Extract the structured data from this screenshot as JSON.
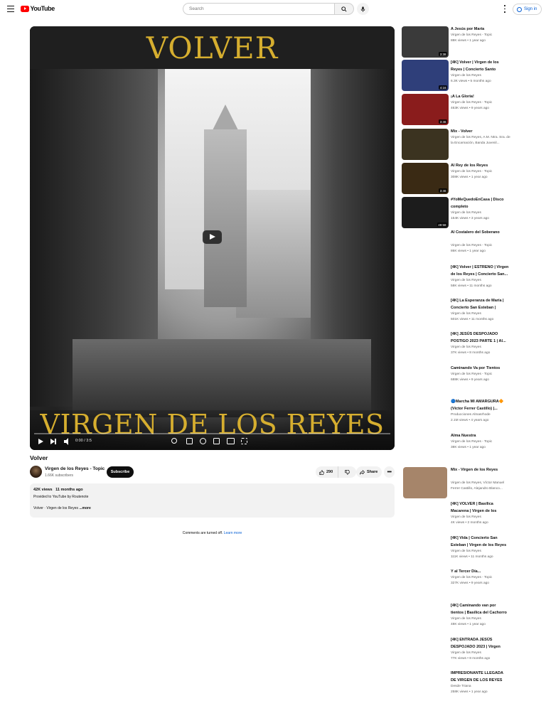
{
  "header": {
    "logo_text": "YouTube",
    "search_placeholder": "Search",
    "signin_label": "Sign in"
  },
  "player": {
    "overlay_title_top": "VOLVER",
    "overlay_title_bottom": "VIRGEN DE LOS REYES",
    "time": "0:00 / 3:5",
    "progress": 0
  },
  "video": {
    "title": "Volver",
    "channel_name": "Virgen de los Reyes - Topic",
    "subscribers": "1.66K subscribers",
    "subscribe_label": "Subscribe",
    "likes": "290",
    "share_label": "Share",
    "views": "42K views",
    "date": "11 months ago",
    "desc_line1": "Provided to YouTube by Routenote",
    "desc_line2": "Volver · Virgen de los Reyes",
    "more_label": "...more",
    "comments_off": "Comments are turned off.",
    "learn_more": "Learn more"
  },
  "recommendations": [
    {
      "title": "A Jesús por María",
      "channel": "Virgen de los Reyes - Topic",
      "meta": "88K views • 1 year ago",
      "duration": "3:38",
      "color": "#3a3a3a"
    },
    {
      "title": "[4K] Volver | Virgen de los Reyes | Concierto Santo Ángel...",
      "channel": "Virgen de los Reyes",
      "meta": "6.3K views • 5 months ago",
      "duration": "4:16",
      "color": "#2f3f7a"
    },
    {
      "title": "¡A La Gloria!",
      "channel": "Virgen de los Reyes - Topic",
      "meta": "463K views • 9 years ago",
      "duration": "3:46",
      "color": "#8a1c1c"
    },
    {
      "title": "Mix - Volver",
      "channel": "Virgen de los Reyes, A.M. Ntra. Sra. de la Encarnación, Banda Juvenil...",
      "meta": "",
      "duration": "",
      "color": "#3b3320"
    },
    {
      "title": "Al Rey de los Reyes",
      "channel": "Virgen de los Reyes - Topic",
      "meta": "308K views • 1 year ago",
      "duration": "3:46",
      "color": "#3a2a14"
    },
    {
      "title": "#YoMeQuedoEnCasa | Disco completo",
      "channel": "Virgen de los Reyes",
      "meta": "154K views • 3 years ago",
      "duration": "49:58",
      "color": "#1c1c1c"
    },
    {
      "title": "Al Costalero del Soberano",
      "channel": "Virgen de los Reyes - Topic",
      "meta": "86K views • 1 year ago",
      "duration": "",
      "color": ""
    },
    {
      "title": "[4K] Volver | ESTRENO | Virgen de los Reyes | Concierto San...",
      "channel": "Virgen de los Reyes",
      "meta": "58K views • 11 months ago",
      "duration": "",
      "color": ""
    },
    {
      "title": "[4K] La Esperanza de María | Concierto San Esteban | Virge...",
      "channel": "Virgen de los Reyes",
      "meta": "501K views • 11 months ago",
      "duration": "",
      "color": ""
    },
    {
      "title": "[4K] JESÚS DESPOJADO POSTIGO 2023 PARTE 1 | Al...",
      "channel": "Virgen de los Reyes",
      "meta": "37K views • 8 months ago",
      "duration": "",
      "color": ""
    },
    {
      "title": "Caminando Va por Tientos",
      "channel": "Virgen de los Reyes - Topic",
      "meta": "688K views • 9 years ago",
      "duration": "",
      "color": ""
    },
    {
      "title": "🔵Marcha MI AMARGURA🔶 (Víctor Ferrer Castillo) |...",
      "channel": "Producciones Almasrhode",
      "meta": "2.1M views • 4 years ago",
      "duration": "",
      "color": ""
    },
    {
      "title": "Alma Nuestra",
      "channel": "Virgen de los Reyes - Topic",
      "meta": "38K views • 1 year ago",
      "duration": "",
      "color": ""
    },
    {
      "title": "Mix - Virgen de los Reyes",
      "channel": "Virgen de los Reyes, Víctor Manuel Ferrer Castillo, Alejandro Blanco...",
      "meta": "",
      "duration": "",
      "color": "#a6856a"
    },
    {
      "title": "[4K] VOLVER | Basílica Macarena | Virgen de los Reye...",
      "channel": "Virgen de los Reyes",
      "meta": "4K views • 2 months ago",
      "duration": "",
      "color": ""
    },
    {
      "title": "[4K] Vida | Concierto San Esteban | Virgen de los Reyes",
      "channel": "Virgen de los Reyes",
      "meta": "111K views • 11 months ago",
      "duration": "",
      "color": ""
    },
    {
      "title": "Y al Tercer Día...",
      "channel": "Virgen de los Reyes - Topic",
      "meta": "327K views • 9 years ago",
      "duration": "",
      "color": ""
    },
    {
      "title": "[4K] Caminando van por tientos | Basílica del Cachorro",
      "channel": "Virgen de los Reyes",
      "meta": "48K views • 1 year ago",
      "duration": "",
      "color": ""
    },
    {
      "title": "[4K] ENTRADA JESÚS DESPOJADO 2023 | Virgen de...",
      "channel": "Virgen de los Reyes",
      "meta": "77K views • 8 months ago",
      "duration": "",
      "color": ""
    },
    {
      "title": "IMPRESIONANTE LLEGADA DE VIRGEN DE LOS REYES A...",
      "channel": "Desde Triana",
      "meta": "258K views • 1 year ago",
      "duration": "",
      "color": ""
    }
  ]
}
